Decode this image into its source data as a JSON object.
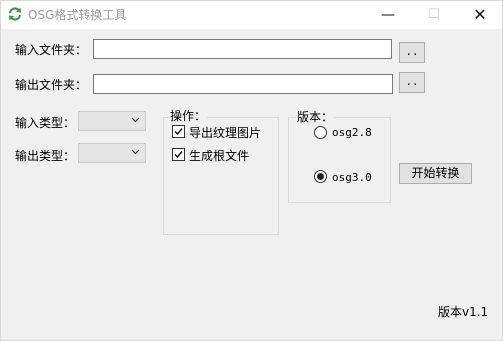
{
  "window": {
    "title": "OSG格式转换工具",
    "minimize": "—",
    "maximize": "☐",
    "close": "✕"
  },
  "input_folder": {
    "label": "输入文件夹：",
    "value": "",
    "browse_label": ".."
  },
  "output_folder": {
    "label": "输出文件夹：",
    "value": "",
    "browse_label": ".."
  },
  "input_type": {
    "label": "输入类型：",
    "selected": ""
  },
  "output_type": {
    "label": "输出类型：",
    "selected": ""
  },
  "operations": {
    "title": "操作：",
    "export_textures": {
      "label": "导出纹理图片",
      "checked": true
    },
    "generate_root": {
      "label": "生成根文件",
      "checked": true
    }
  },
  "version_group": {
    "title": "版本：",
    "options": [
      {
        "label": "osg2.8",
        "selected": false
      },
      {
        "label": "osg3.0",
        "selected": true
      }
    ]
  },
  "start_button": {
    "label": "开始转换"
  },
  "footer": {
    "version_text": "版本v1.1"
  }
}
